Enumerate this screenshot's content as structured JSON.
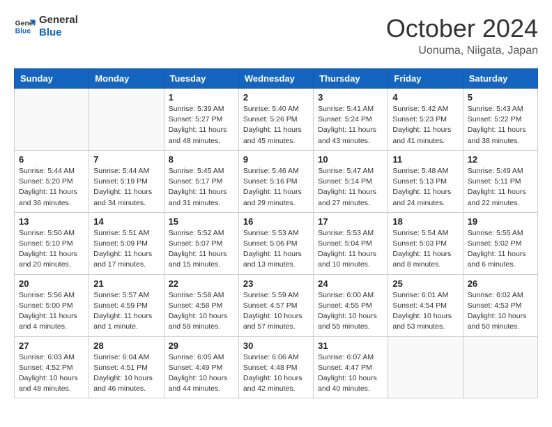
{
  "logo": {
    "line1": "General",
    "line2": "Blue"
  },
  "title": "October 2024",
  "location": "Uonuma, Niigata, Japan",
  "weekdays": [
    "Sunday",
    "Monday",
    "Tuesday",
    "Wednesday",
    "Thursday",
    "Friday",
    "Saturday"
  ],
  "weeks": [
    [
      {
        "day": "",
        "info": ""
      },
      {
        "day": "",
        "info": ""
      },
      {
        "day": "1",
        "info": "Sunrise: 5:39 AM\nSunset: 5:27 PM\nDaylight: 11 hours and 48 minutes."
      },
      {
        "day": "2",
        "info": "Sunrise: 5:40 AM\nSunset: 5:26 PM\nDaylight: 11 hours and 45 minutes."
      },
      {
        "day": "3",
        "info": "Sunrise: 5:41 AM\nSunset: 5:24 PM\nDaylight: 11 hours and 43 minutes."
      },
      {
        "day": "4",
        "info": "Sunrise: 5:42 AM\nSunset: 5:23 PM\nDaylight: 11 hours and 41 minutes."
      },
      {
        "day": "5",
        "info": "Sunrise: 5:43 AM\nSunset: 5:22 PM\nDaylight: 11 hours and 38 minutes."
      }
    ],
    [
      {
        "day": "6",
        "info": "Sunrise: 5:44 AM\nSunset: 5:20 PM\nDaylight: 11 hours and 36 minutes."
      },
      {
        "day": "7",
        "info": "Sunrise: 5:44 AM\nSunset: 5:19 PM\nDaylight: 11 hours and 34 minutes."
      },
      {
        "day": "8",
        "info": "Sunrise: 5:45 AM\nSunset: 5:17 PM\nDaylight: 11 hours and 31 minutes."
      },
      {
        "day": "9",
        "info": "Sunrise: 5:46 AM\nSunset: 5:16 PM\nDaylight: 11 hours and 29 minutes."
      },
      {
        "day": "10",
        "info": "Sunrise: 5:47 AM\nSunset: 5:14 PM\nDaylight: 11 hours and 27 minutes."
      },
      {
        "day": "11",
        "info": "Sunrise: 5:48 AM\nSunset: 5:13 PM\nDaylight: 11 hours and 24 minutes."
      },
      {
        "day": "12",
        "info": "Sunrise: 5:49 AM\nSunset: 5:11 PM\nDaylight: 11 hours and 22 minutes."
      }
    ],
    [
      {
        "day": "13",
        "info": "Sunrise: 5:50 AM\nSunset: 5:10 PM\nDaylight: 11 hours and 20 minutes."
      },
      {
        "day": "14",
        "info": "Sunrise: 5:51 AM\nSunset: 5:09 PM\nDaylight: 11 hours and 17 minutes."
      },
      {
        "day": "15",
        "info": "Sunrise: 5:52 AM\nSunset: 5:07 PM\nDaylight: 11 hours and 15 minutes."
      },
      {
        "day": "16",
        "info": "Sunrise: 5:53 AM\nSunset: 5:06 PM\nDaylight: 11 hours and 13 minutes."
      },
      {
        "day": "17",
        "info": "Sunrise: 5:53 AM\nSunset: 5:04 PM\nDaylight: 11 hours and 10 minutes."
      },
      {
        "day": "18",
        "info": "Sunrise: 5:54 AM\nSunset: 5:03 PM\nDaylight: 11 hours and 8 minutes."
      },
      {
        "day": "19",
        "info": "Sunrise: 5:55 AM\nSunset: 5:02 PM\nDaylight: 11 hours and 6 minutes."
      }
    ],
    [
      {
        "day": "20",
        "info": "Sunrise: 5:56 AM\nSunset: 5:00 PM\nDaylight: 11 hours and 4 minutes."
      },
      {
        "day": "21",
        "info": "Sunrise: 5:57 AM\nSunset: 4:59 PM\nDaylight: 11 hours and 1 minute."
      },
      {
        "day": "22",
        "info": "Sunrise: 5:58 AM\nSunset: 4:58 PM\nDaylight: 10 hours and 59 minutes."
      },
      {
        "day": "23",
        "info": "Sunrise: 5:59 AM\nSunset: 4:57 PM\nDaylight: 10 hours and 57 minutes."
      },
      {
        "day": "24",
        "info": "Sunrise: 6:00 AM\nSunset: 4:55 PM\nDaylight: 10 hours and 55 minutes."
      },
      {
        "day": "25",
        "info": "Sunrise: 6:01 AM\nSunset: 4:54 PM\nDaylight: 10 hours and 53 minutes."
      },
      {
        "day": "26",
        "info": "Sunrise: 6:02 AM\nSunset: 4:53 PM\nDaylight: 10 hours and 50 minutes."
      }
    ],
    [
      {
        "day": "27",
        "info": "Sunrise: 6:03 AM\nSunset: 4:52 PM\nDaylight: 10 hours and 48 minutes."
      },
      {
        "day": "28",
        "info": "Sunrise: 6:04 AM\nSunset: 4:51 PM\nDaylight: 10 hours and 46 minutes."
      },
      {
        "day": "29",
        "info": "Sunrise: 6:05 AM\nSunset: 4:49 PM\nDaylight: 10 hours and 44 minutes."
      },
      {
        "day": "30",
        "info": "Sunrise: 6:06 AM\nSunset: 4:48 PM\nDaylight: 10 hours and 42 minutes."
      },
      {
        "day": "31",
        "info": "Sunrise: 6:07 AM\nSunset: 4:47 PM\nDaylight: 10 hours and 40 minutes."
      },
      {
        "day": "",
        "info": ""
      },
      {
        "day": "",
        "info": ""
      }
    ]
  ]
}
